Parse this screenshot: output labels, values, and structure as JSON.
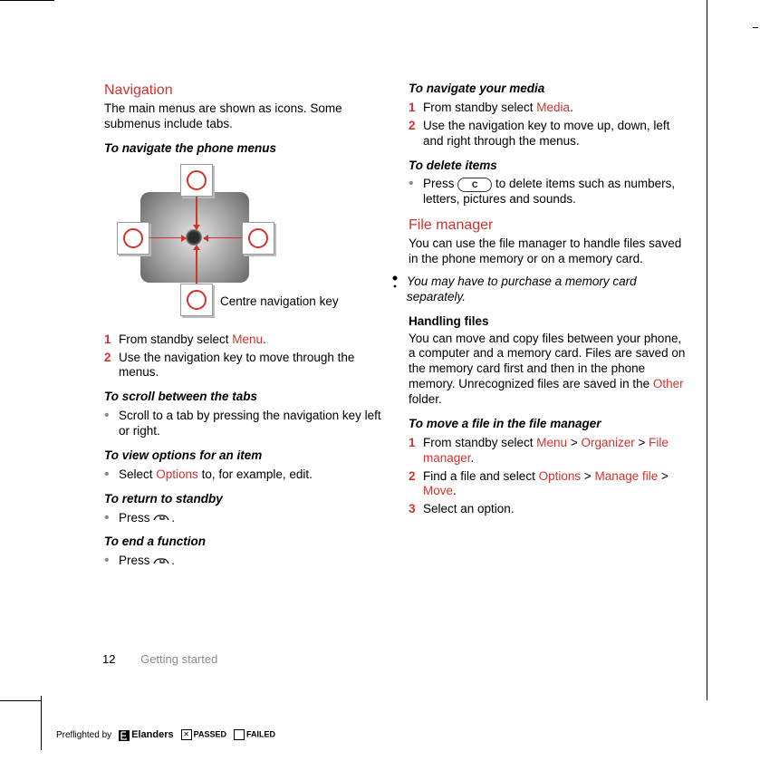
{
  "left": {
    "navigation_heading": "Navigation",
    "navigation_intro": "The main menus are shown as icons. Some submenus include tabs.",
    "navigate_menus_title": "To navigate the phone menus",
    "centre_key_label": "Centre navigation key",
    "steps1": {
      "n1": "1",
      "s1a": "From standby select ",
      "s1b": "Menu",
      "s1c": ".",
      "n2": "2",
      "s2": "Use the navigation key to move through the menus."
    },
    "scroll_tabs_title": "To scroll between the tabs",
    "scroll_tabs_item": "Scroll to a tab by pressing the navigation key left or right.",
    "view_options_title": "To view options for an item",
    "view_options_a": "Select ",
    "view_options_b": "Options",
    "view_options_c": " to, for example, edit.",
    "return_standby_title": "To return to standby",
    "press_a": "Press ",
    "press_dot": ".",
    "end_function_title": "To end a function"
  },
  "right": {
    "navigate_media_title": "To navigate your media",
    "media_steps": {
      "n1": "1",
      "s1a": "From standby select ",
      "s1b": "Media",
      "s1c": ".",
      "n2": "2",
      "s2": "Use the navigation key to move up, down, left and right through the menus."
    },
    "delete_title": "To delete items",
    "delete_a": "Press ",
    "delete_key": "C",
    "delete_b": " to delete items such as numbers, letters, pictures and sounds.",
    "fm_heading": "File manager",
    "fm_intro": "You can use the file manager to handle files saved in the phone memory or on a memory card.",
    "note": "You may have to purchase a memory card separately.",
    "handling_title": "Handling files",
    "handling_a": "You can move and copy files between your phone, a computer and a memory card. Files are saved on the memory card first and then in the phone memory. Unrecognized files are saved in the ",
    "handling_b": "Other",
    "handling_c": " folder.",
    "move_title": "To move a file in the file manager",
    "move_steps": {
      "n1": "1",
      "s1a": "From standby select ",
      "s1b": "Menu",
      "s1c": " > ",
      "s1d": "Organizer",
      "s1e": " > ",
      "s1f": "File manager",
      "s1g": ".",
      "n2": "2",
      "s2a": "Find a file and select ",
      "s2b": "Options",
      "s2c": " > ",
      "s2d": "Manage file",
      "s2e": " > ",
      "s2f": "Move",
      "s2g": ".",
      "n3": "3",
      "s3": "Select an option."
    }
  },
  "footer": {
    "page": "12",
    "section": "Getting started"
  },
  "preflight": {
    "by": "Preflighted by",
    "brand": "Elanders",
    "passed": "PASSED",
    "failed": "FAILED"
  }
}
